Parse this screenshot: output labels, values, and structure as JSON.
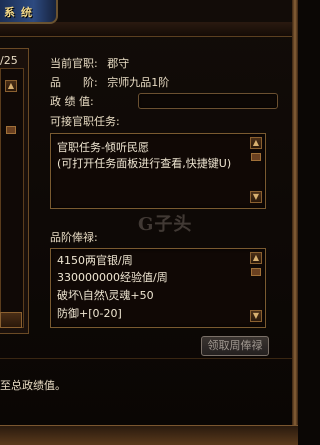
{
  "window": {
    "title": "系统"
  },
  "left": {
    "count_text": "/25"
  },
  "official": {
    "rank_label": "当前官职:",
    "rank_value": "郡守",
    "grade_label": "品　　阶:",
    "grade_value": "宗师九品1阶",
    "merit_label": "政 绩 值:",
    "merit_value": ""
  },
  "tasks": {
    "header": "可接官职任务:",
    "lines": [
      "官职任务-倾听民愿",
      "(可打开任务面板进行查看,快捷键U)"
    ]
  },
  "salary": {
    "header": "品阶俸禄:",
    "lines": [
      "4150两官银/周",
      "330000000经验值/周",
      "破坏\\自然\\灵魂+50",
      "防御+[0-20]"
    ],
    "claim_button": "领取周俸禄"
  },
  "watermark": "G子头",
  "footer": {
    "text": "至总政绩值。"
  },
  "colors": {
    "text": "#e8dcc4",
    "border": "#7a5a30",
    "title": "#f3d98a"
  }
}
